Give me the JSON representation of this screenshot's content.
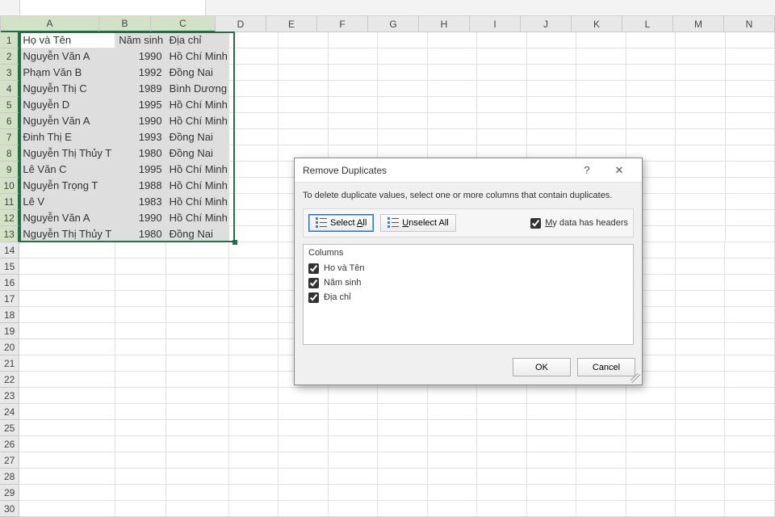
{
  "columns": [
    "A",
    "B",
    "C",
    "D",
    "E",
    "F",
    "G",
    "H",
    "I",
    "J",
    "K",
    "L",
    "M",
    "N"
  ],
  "selected_cols": [
    "A",
    "B",
    "C"
  ],
  "headers": {
    "A": "Họ và Tên",
    "B": "Năm sinh",
    "C": "Địa chỉ"
  },
  "data": [
    {
      "n": 1,
      "A": "Họ và Tên",
      "B": "Năm sinh",
      "C": "Địa chỉ"
    },
    {
      "n": 2,
      "A": "Nguyễn Văn A",
      "B": "1990",
      "C": "Hồ Chí Minh"
    },
    {
      "n": 3,
      "A": "Phạm Văn B",
      "B": "1992",
      "C": "Đồng Nai"
    },
    {
      "n": 4,
      "A": "Nguyễn Thị C",
      "B": "1989",
      "C": "Bình Dương"
    },
    {
      "n": 5,
      "A": "Nguyễn D",
      "B": "1995",
      "C": "Hồ Chí Minh"
    },
    {
      "n": 6,
      "A": "Nguyễn Văn A",
      "B": "1990",
      "C": "Hồ Chí Minh"
    },
    {
      "n": 7,
      "A": "Đinh Thị E",
      "B": "1993",
      "C": "Đồng Nai"
    },
    {
      "n": 8,
      "A": "Nguyễn Thị Thủy T",
      "B": "1980",
      "C": "Đồng Nai"
    },
    {
      "n": 9,
      "A": "Lê Văn C",
      "B": "1995",
      "C": "Hồ Chí Minh"
    },
    {
      "n": 10,
      "A": "Nguyễn Trọng T",
      "B": "1988",
      "C": "Hồ Chí Minh"
    },
    {
      "n": 11,
      "A": "Lê V",
      "B": "1983",
      "C": "Hồ Chí Minh"
    },
    {
      "n": 12,
      "A": "Nguyễn Văn A",
      "B": "1990",
      "C": "Hồ Chí Minh"
    },
    {
      "n": 13,
      "A": "Nguyễn Thị Thủy T",
      "B": "1980",
      "C": "Đồng Nai"
    }
  ],
  "row_count": 30,
  "selection": {
    "r1": 1,
    "r2": 13
  },
  "dialog": {
    "title": "Remove Duplicates",
    "message": "To delete duplicate values, select one or more columns that contain duplicates.",
    "select_all": "Select All",
    "select_all_key": "A",
    "unselect_all": "Unselect All",
    "unselect_all_key": "U",
    "headers_label": "My data has headers",
    "headers_key": "M",
    "headers_checked": true,
    "columns_header": "Columns",
    "columns": [
      {
        "label": "Ho và Tên",
        "checked": true
      },
      {
        "label": "Năm sinh",
        "checked": true
      },
      {
        "label": "Địa chỉ",
        "checked": true
      }
    ],
    "ok": "OK",
    "cancel": "Cancel",
    "help": "?",
    "close": "✕"
  }
}
